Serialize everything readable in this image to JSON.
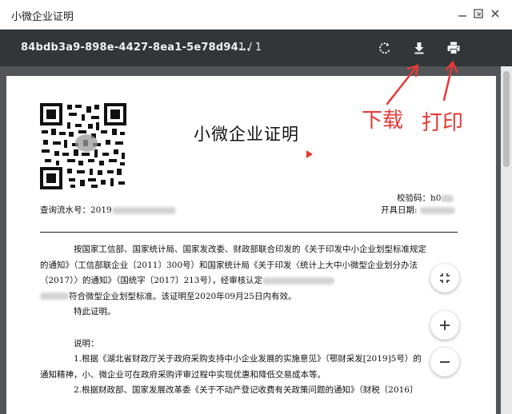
{
  "window": {
    "title": "小微企业证明",
    "controls": [
      "minimize",
      "maximize",
      "close"
    ]
  },
  "toolbar": {
    "filename": "84bdb3a9-898e-4427-8ea1-5e78d94...",
    "page_indicator": "1 / 1",
    "icons": [
      "rotate-icon",
      "download-icon",
      "print-icon"
    ]
  },
  "annotations": {
    "download_label": "下载",
    "print_label": "打印",
    "color": "#e53935"
  },
  "document": {
    "title": "小微企业证明",
    "check_code_label": "校验码：h0",
    "query_serial_label": "查询流水号：2019",
    "issue_date_label": "开具日期:",
    "para1_line1": "按国家工信部、国家统计局、国家发改委、财政部联合印发的《关于印发中小企业划型标准规定",
    "para1_line2": "的通知》（工信部联企业〔2011〕300号）和国家统计局《关于印发〈统计上大中小微型企业划分办法",
    "para1_line3": "（2017）〉的通知》（国统字〔2017〕213号），经审核认定",
    "para1_line4": "符合微型企业划型标准。该证明至2020年09月25日内有效。",
    "para2": "特此证明。",
    "notes_title": "说明：",
    "note1_line1": "1.根据《湖北省财政厅关于政府采购支持中小企业发展的实施意见》（鄂财采发[2019]5号）的",
    "note1_line2": "通知精神，小、微企业可在政府采购评审过程中实现优惠和降低交易成本等。",
    "note2_line1": "2.根据财政部、国家发展改革委《关于不动产登记收费有关政策问题的通知》（财税〔2016〕"
  },
  "zoom_controls": [
    "fit-to-page",
    "zoom-in",
    "zoom-out"
  ]
}
